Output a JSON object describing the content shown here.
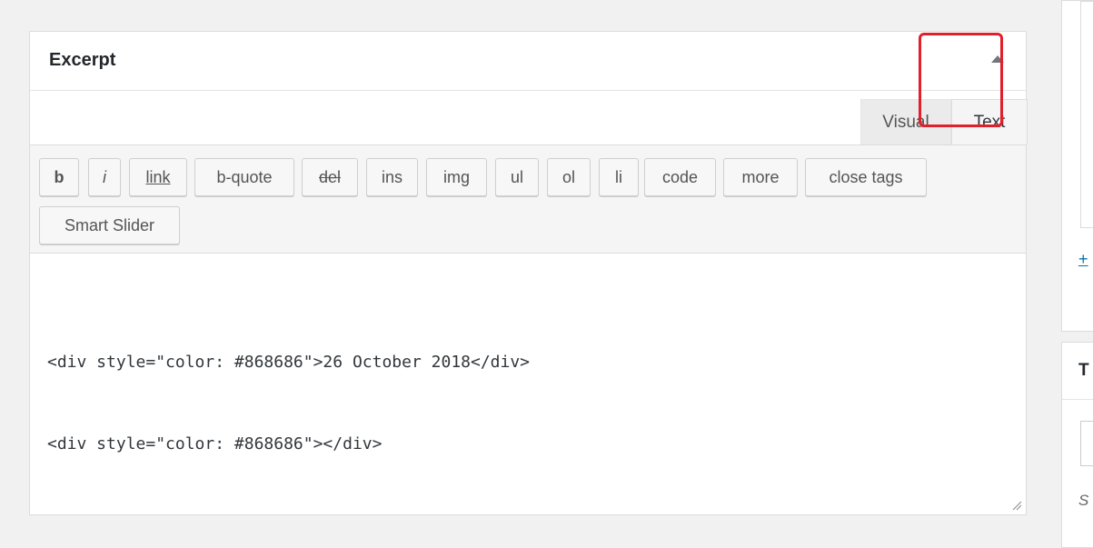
{
  "excerpt_box": {
    "title": "Excerpt",
    "tabs": {
      "visual": "Visual",
      "text": "Text"
    },
    "toolbar_buttons": [
      "b",
      "i",
      "link",
      "b-quote",
      "del",
      "ins",
      "img",
      "ul",
      "ol",
      "li",
      "code",
      "more",
      "close tags",
      "Smart Slider"
    ],
    "content_lines": [
      "<div style=\"color: #868686\">26 October 2018</div>",
      "<div style=\"color: #868686\"></div>"
    ]
  },
  "sidebar": {
    "link_fragment": "+",
    "second_box_title_fragment": "T",
    "note_fragment": "S"
  },
  "colors": {
    "highlight": "#e0202b",
    "link": "#0073aa"
  }
}
